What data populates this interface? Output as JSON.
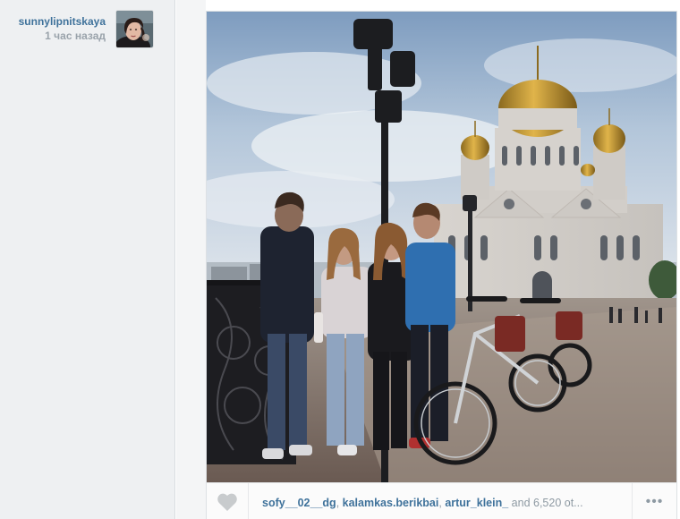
{
  "post": {
    "author": "sunnylipnitskaya",
    "time": "1 час назад"
  },
  "likes": {
    "users": [
      "sofy__02__dg",
      "kalamkas.berikbai",
      "artur_klein_"
    ],
    "rest": "and 6,520 ot..."
  },
  "icons": {
    "like": "heart-icon",
    "more": "more-dots-icon"
  },
  "more": {
    "label": "•••"
  },
  "colors": {
    "username": "#3f729b",
    "timestamp": "#9aa3ab",
    "sidebar_bg": "#eef0f2",
    "heart": "#c8cbcd"
  }
}
